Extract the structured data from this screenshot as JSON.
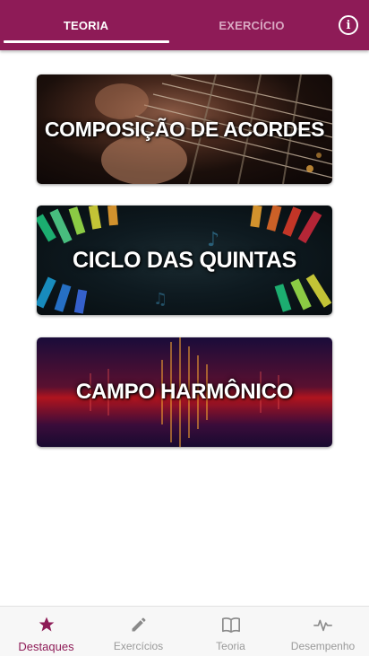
{
  "tabs": {
    "teoria": "TEORIA",
    "exercicio": "EXERCÍCIO",
    "active": "teoria"
  },
  "cards": [
    {
      "label": "COMPOSIÇÃO DE ACORDES"
    },
    {
      "label": "CICLO DAS QUINTAS"
    },
    {
      "label": "CAMPO HARMÔNICO"
    }
  ],
  "bottom_nav": {
    "items": [
      {
        "label": "Destaques",
        "icon": "star-icon",
        "active": true
      },
      {
        "label": "Exercícios",
        "icon": "pencil-icon",
        "active": false
      },
      {
        "label": "Teoria",
        "icon": "book-icon",
        "active": false
      },
      {
        "label": "Desempenho",
        "icon": "pulse-icon",
        "active": false
      }
    ]
  },
  "colors": {
    "primary": "#8e1b57",
    "tab_inactive": "#d9a8c2",
    "nav_inactive": "#9a9a9a"
  }
}
